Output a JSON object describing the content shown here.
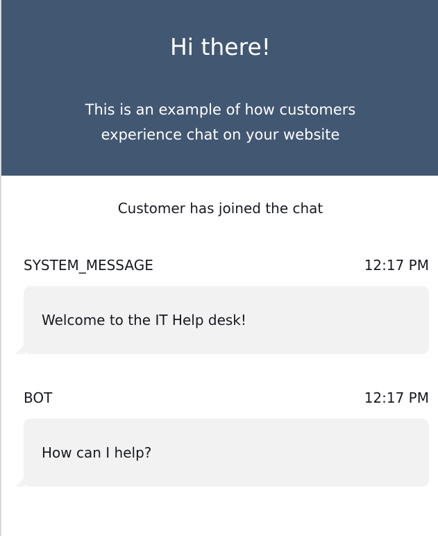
{
  "header": {
    "title": "Hi there!",
    "subtitle": "This is an example of how customers experience chat on your website"
  },
  "chat": {
    "join_notice": "Customer has joined the chat",
    "messages": [
      {
        "sender": "SYSTEM_MESSAGE",
        "time": "12:17 PM",
        "text": "Welcome to the IT Help desk!"
      },
      {
        "sender": "BOT",
        "time": "12:17 PM",
        "text": "How can I help?"
      }
    ]
  },
  "colors": {
    "header_background": "#425772",
    "header_text": "#ffffff",
    "bubble_background": "#f2f2f2",
    "text": "#16191f"
  }
}
